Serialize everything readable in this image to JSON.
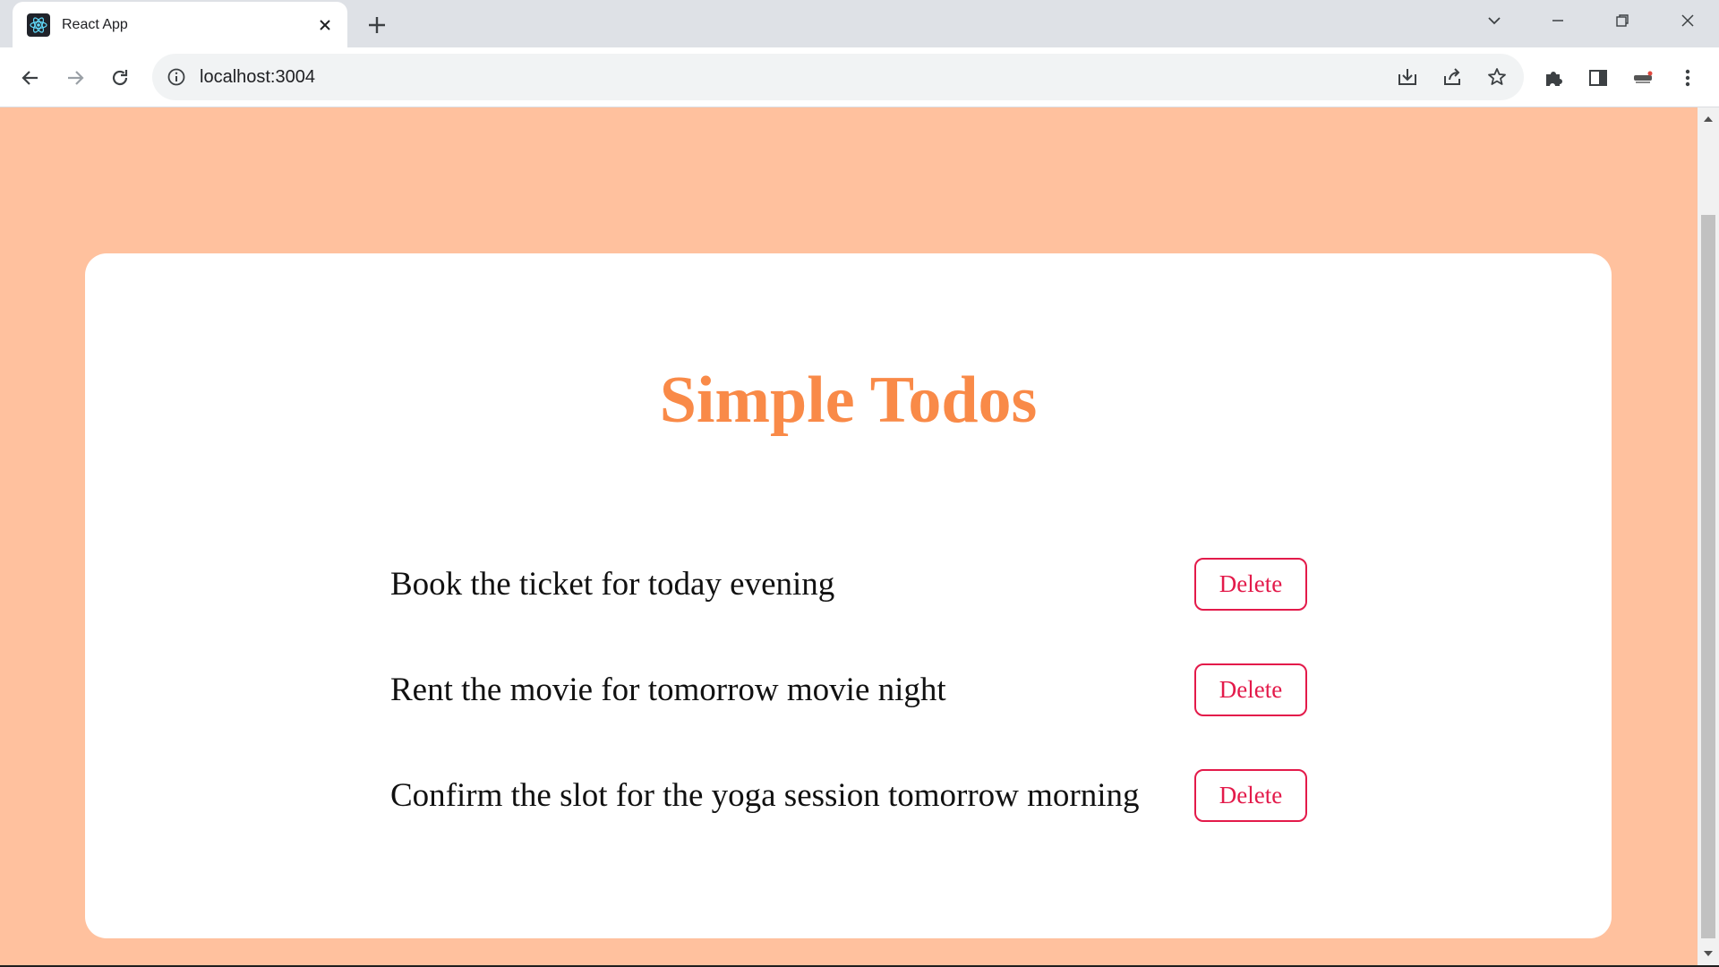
{
  "browser": {
    "tab_title": "React App",
    "url": "localhost:3004"
  },
  "app": {
    "heading": "Simple Todos",
    "todos": [
      {
        "text": "Book the ticket for today evening",
        "action": "Delete"
      },
      {
        "text": "Rent the movie for tomorrow movie night",
        "action": "Delete"
      },
      {
        "text": "Confirm the slot for the yoga session tomorrow morning",
        "action": "Delete"
      }
    ]
  },
  "colors": {
    "page_background": "#ffc19e",
    "heading": "#f98a48",
    "delete_accent": "#e31a4a",
    "card": "#ffffff"
  }
}
